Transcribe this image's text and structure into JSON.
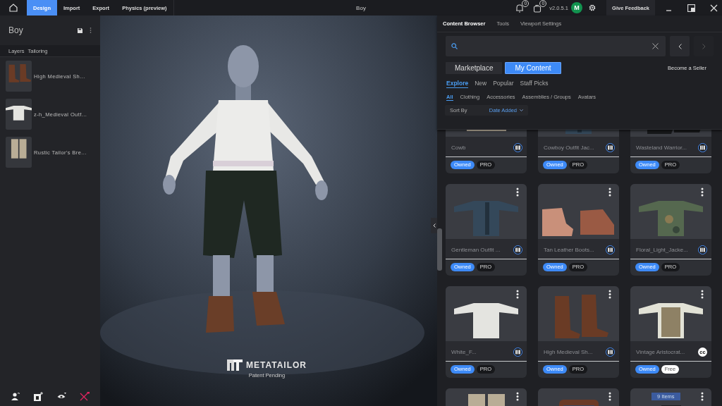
{
  "topbar": {
    "tabs": [
      {
        "label": "Design",
        "selected": true
      },
      {
        "label": "Import",
        "selected": false
      },
      {
        "label": "Export",
        "selected": false
      },
      {
        "label": "Physics (preview)",
        "selected": false
      }
    ],
    "title": "Boy",
    "notifications": "0",
    "downloads": "0",
    "version": "v2.0.5.1",
    "avatar": "M",
    "feedback": "Give Feedback"
  },
  "left_panel": {
    "title": "Boy",
    "tabs": [
      {
        "label": "Layers"
      },
      {
        "label": "Tailoring"
      }
    ],
    "layers": [
      {
        "name": "High Medieval Sh..."
      },
      {
        "name": "z-h_Medieval Outf..."
      },
      {
        "name": "Rustic Tailor's Bre..."
      }
    ]
  },
  "viewport": {
    "logo": "METATAILOR",
    "caption": "Patent Pending"
  },
  "content_browser": {
    "tabs": [
      {
        "label": "Content Browser",
        "selected": true
      },
      {
        "label": "Tools",
        "selected": false
      },
      {
        "label": "Viewport Settings",
        "selected": false
      }
    ],
    "back_disabled": false,
    "forward_disabled": true,
    "sources": [
      {
        "label": "Marketplace",
        "selected": false
      },
      {
        "label": "My Content",
        "selected": true
      }
    ],
    "seller_link": "Become a Seller",
    "sections": [
      {
        "label": "Explore",
        "selected": true
      },
      {
        "label": "New",
        "selected": false
      },
      {
        "label": "Popular",
        "selected": false
      },
      {
        "label": "Staff Picks",
        "selected": false
      }
    ],
    "filters": [
      {
        "label": "All",
        "selected": true
      },
      {
        "label": "Clothing",
        "selected": false
      },
      {
        "label": "Accessories",
        "selected": false
      },
      {
        "label": "Assemblies / Groups",
        "selected": false
      },
      {
        "label": "Avatars",
        "selected": false
      }
    ],
    "sort": {
      "label": "Sort By",
      "value": "Date Added"
    },
    "cards": [
      {
        "name": "Cowb",
        "menu": false,
        "license": {
          "kind": "mt"
        },
        "tags": [
          {
            "label": "Owned",
            "kind": "owned"
          },
          {
            "label": "PRO",
            "kind": "pro"
          }
        ]
      },
      {
        "name": "Cowboy Outfit Jac...",
        "menu": false,
        "license": {
          "kind": "mt"
        },
        "tags": [
          {
            "label": "Owned",
            "kind": "owned"
          },
          {
            "label": "PRO",
            "kind": "pro"
          }
        ]
      },
      {
        "name": "Wasteland Warrior...",
        "menu": false,
        "license": {
          "kind": "mt"
        },
        "tags": [
          {
            "label": "Owned",
            "kind": "owned"
          },
          {
            "label": "PRO",
            "kind": "pro"
          }
        ]
      },
      {
        "name": "Gentleman Outfit ...",
        "menu": true,
        "license": {
          "kind": "mt"
        },
        "tags": [
          {
            "label": "Owned",
            "kind": "owned"
          },
          {
            "label": "PRO",
            "kind": "pro"
          }
        ]
      },
      {
        "name": "Tan Leather Boots...",
        "menu": true,
        "license": {
          "kind": "mt"
        },
        "tags": [
          {
            "label": "Owned",
            "kind": "owned"
          },
          {
            "label": "PRO",
            "kind": "pro"
          }
        ]
      },
      {
        "name": "Floral_Light_Jacke...",
        "menu": true,
        "license": {
          "kind": "mt"
        },
        "tags": [
          {
            "label": "Owned",
            "kind": "owned"
          },
          {
            "label": "PRO",
            "kind": "pro"
          }
        ]
      },
      {
        "name": "White_F...",
        "menu": true,
        "license": {
          "kind": "mt"
        },
        "tags": [
          {
            "label": "Owned",
            "kind": "owned"
          },
          {
            "label": "PRO",
            "kind": "pro"
          }
        ]
      },
      {
        "name": "High Medieval Sh...",
        "menu": true,
        "license": {
          "kind": "mt"
        },
        "tags": [
          {
            "label": "Owned",
            "kind": "owned"
          },
          {
            "label": "PRO",
            "kind": "pro"
          }
        ]
      },
      {
        "name": "Vintage Aristocrat...",
        "menu": true,
        "license": {
          "kind": "cc",
          "label": "cc"
        },
        "tags": [
          {
            "label": "Owned",
            "kind": "owned"
          },
          {
            "label": "Free",
            "kind": "free"
          }
        ]
      },
      {
        "menu": true
      },
      {
        "menu": true
      },
      {
        "menu": true,
        "count": "9 Items"
      }
    ]
  }
}
